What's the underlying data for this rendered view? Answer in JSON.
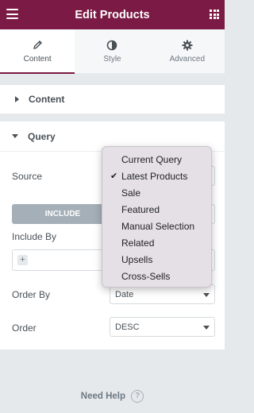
{
  "header": {
    "title": "Edit Products",
    "menu_icon": "hamburger-menu-icon",
    "apps_icon": "grid-apps-icon",
    "background": "#7b1a44"
  },
  "tabs": [
    {
      "label": "Content",
      "icon": "pencil-icon",
      "active": true
    },
    {
      "label": "Style",
      "icon": "half-circle-icon",
      "active": false
    },
    {
      "label": "Advanced",
      "icon": "gear-icon",
      "active": false
    }
  ],
  "sections": {
    "content": {
      "title": "Content",
      "collapsed": true
    },
    "query": {
      "title": "Query",
      "collapsed": false
    }
  },
  "query": {
    "source_label": "Source",
    "include_button": "INCLUDE",
    "include_by_label": "Include By",
    "order_by_label": "Order By",
    "order_by_value": "Date",
    "order_label": "Order",
    "order_value": "DESC"
  },
  "dropdown": {
    "options": [
      "Current Query",
      "Latest Products",
      "Sale",
      "Featured",
      "Manual Selection",
      "Related",
      "Upsells",
      "Cross-Sells"
    ],
    "selected": "Latest Products"
  },
  "footer": {
    "need_help": "Need Help",
    "help_icon": "question-circle-icon"
  }
}
